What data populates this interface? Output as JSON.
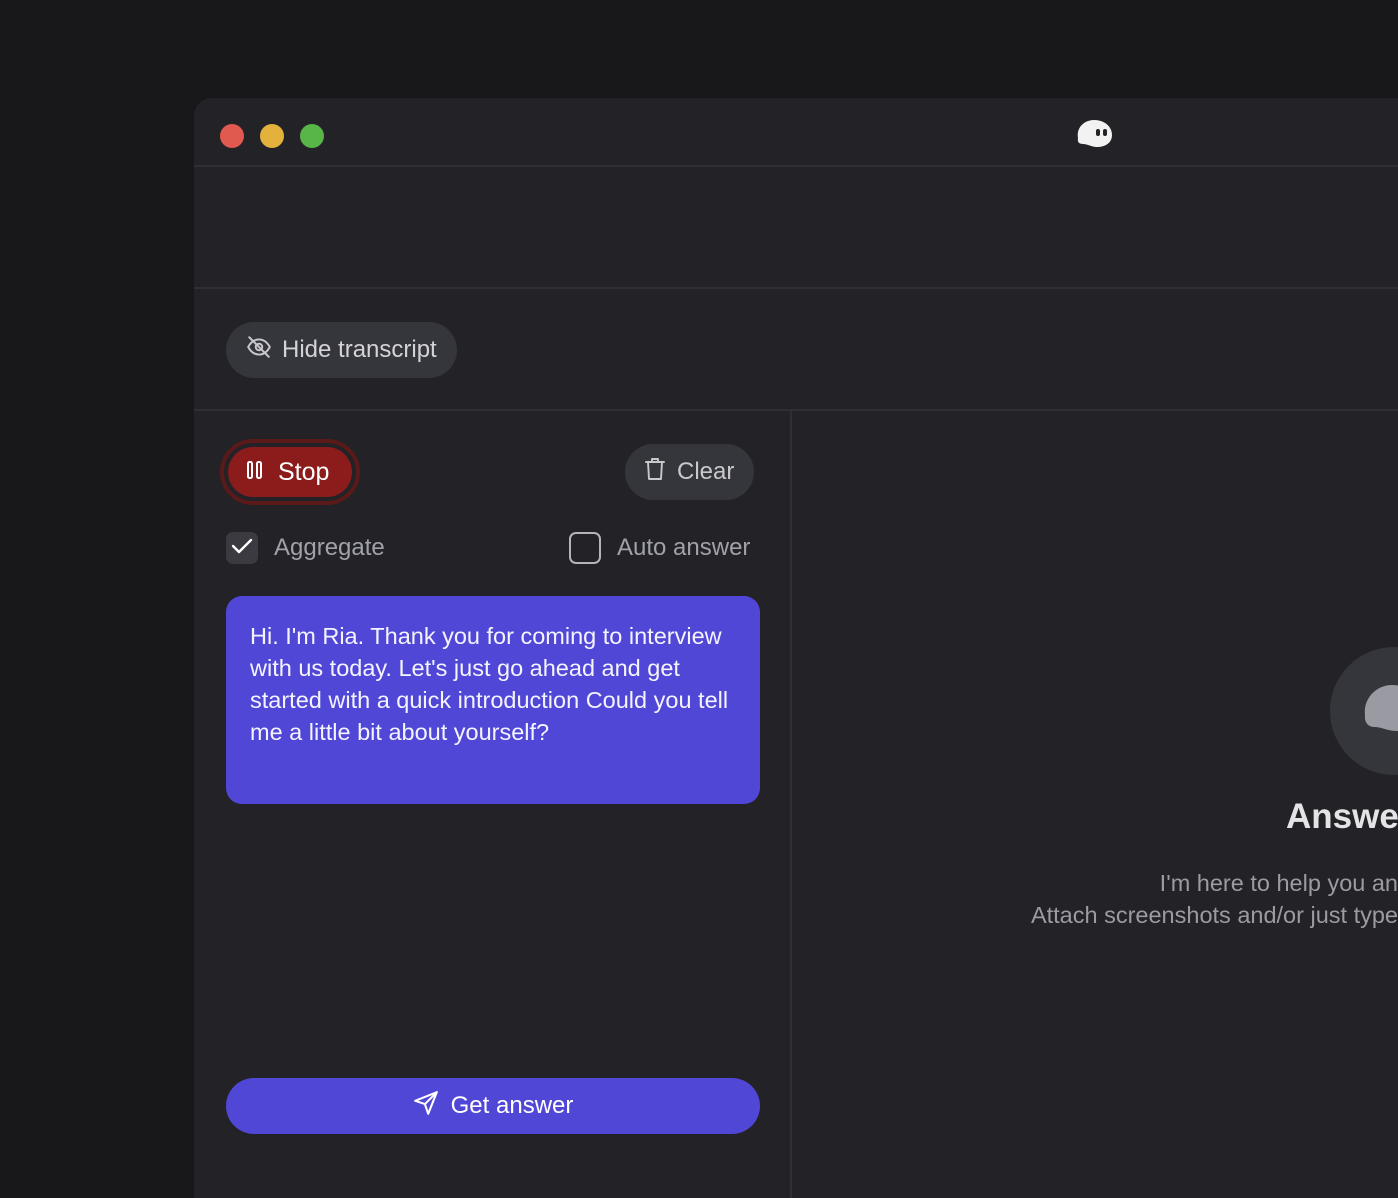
{
  "window": {
    "controls": [
      "close",
      "minimize",
      "maximize"
    ],
    "logo_icon": "ghost-icon"
  },
  "toolbar": {
    "hide_transcript_label": "Hide transcript",
    "hide_transcript_icon": "eye-off-icon"
  },
  "transcript": {
    "stop_label": "Stop",
    "stop_icon": "pause-icon",
    "clear_label": "Clear",
    "clear_icon": "trash-icon",
    "aggregate_label": "Aggregate",
    "aggregate_checked": true,
    "auto_answer_label": "Auto answer",
    "auto_answer_checked": false,
    "messages": [
      {
        "text": "Hi. I'm Ria. Thank you for coming to interview with us today. Let's just go ahead and get started with a quick introduction Could you tell me a little bit about yourself?"
      }
    ],
    "get_answer_label": "Get answer",
    "get_answer_icon": "send-icon"
  },
  "answer_panel": {
    "title": "Answe",
    "line1": "I'm here to help you an",
    "line2": "Attach screenshots and/or just type"
  },
  "colors": {
    "accent": "#5147d6",
    "stop": "#8c1c1c",
    "background": "#222227"
  }
}
